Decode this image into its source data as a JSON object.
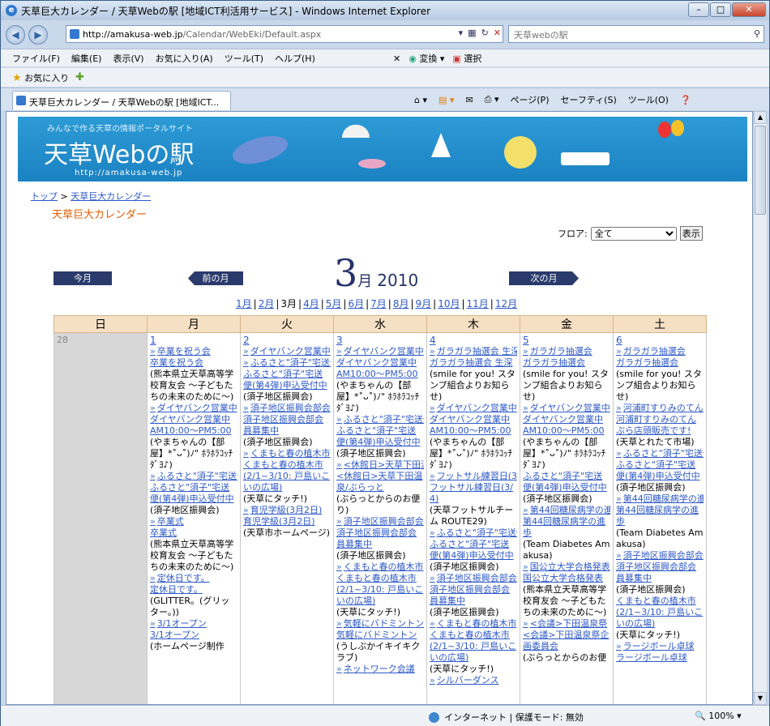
{
  "window": {
    "title": "天草巨大カレンダー / 天草Webの駅 [地域ICT利活用サービス] - Windows Internet Explorer",
    "address_domain": "http://amakusa-web.jp",
    "address_path": "/Calendar/WebEki/Default.aspx",
    "search_placeholder": "天草webの駅"
  },
  "menu": {
    "items": [
      "ファイル(F)",
      "編集(E)",
      "表示(V)",
      "お気に入り(A)",
      "ツール(T)",
      "ヘルプ(H)"
    ],
    "convert": "変換",
    "select": "選択"
  },
  "favorites_label": "お気に入り",
  "tab_label": "天草巨大カレンダー / 天草Webの駅 [地域ICT...",
  "commands": [
    "ページ(P)",
    "セーフティ(S)",
    "ツール(O)"
  ],
  "status": {
    "zone": "インターネット | 保護モード: 無効",
    "zoom": "100%"
  },
  "site": {
    "tagline": "みんなで作る天草の情報ポータルサイト",
    "logo": "天草Webの駅",
    "url": "http://amakusa-web.jp"
  },
  "breadcrumb": {
    "top": "トップ",
    "sep": ">",
    "current": "天草巨大カレンダー"
  },
  "page_title": "天草巨大カレンダー",
  "floor": {
    "label": "フロア:",
    "value": "全て",
    "button": "表示"
  },
  "nav": {
    "this_month": "今月",
    "prev": "前の月",
    "next": "次の月"
  },
  "month": {
    "number": "3",
    "suffix": "月",
    "year": "2010"
  },
  "month_links": [
    "1月",
    "2月",
    "3月",
    "4月",
    "5月",
    "6月",
    "7月",
    "8月",
    "9月",
    "10月",
    "11月",
    "12月"
  ],
  "weekdays": [
    "日",
    "月",
    "火",
    "水",
    "木",
    "金",
    "土"
  ],
  "days": [
    {
      "num": "28",
      "entries": []
    },
    {
      "num": "1",
      "entries": [
        {
          "k": "ev",
          "t": "卒業を祝う会"
        },
        {
          "k": "lk",
          "t": "卒業を祝う会"
        },
        {
          "k": "tx",
          "t": "(熊本県立天草高等学校育友会 ～子どもたちの未来のために～)"
        },
        {
          "k": "ev",
          "t": "ダイヤバンク営業中"
        },
        {
          "k": "lk",
          "t": "ダイヤバンク営業中 AM10:00～PM5:00"
        },
        {
          "k": "tx",
          "t": "(やまちゃんの【部屋】*˚ᴗ˚)ﾉ\" ﾎﾗﾎﾗｺｯﾁﾀﾞﾖ♪)"
        },
        {
          "k": "ev",
          "t": "ふるさと\"須子\"宅送便"
        },
        {
          "k": "lk",
          "t": "ふるさと\"須子\"宅送便(第4弾)申込受付中"
        },
        {
          "k": "tx",
          "t": "(須子地区振興会)"
        },
        {
          "k": "ev",
          "t": "卒業式"
        },
        {
          "k": "lk",
          "t": "卒業式"
        },
        {
          "k": "tx",
          "t": "(熊本県立天草高等学校育友会 ～子どもたちの未来のために～)"
        },
        {
          "k": "ev",
          "t": "定休日です。"
        },
        {
          "k": "lk",
          "t": "定休日です。"
        },
        {
          "k": "tx",
          "t": "(GLITTER。(グリッター。))"
        },
        {
          "k": "ev",
          "t": "3/1オープン"
        },
        {
          "k": "lk",
          "t": "3/1オープン"
        },
        {
          "k": "tx",
          "t": "(ホームページ制作"
        }
      ]
    },
    {
      "num": "2",
      "entries": [
        {
          "k": "ev",
          "t": "ダイヤバンク営業中"
        },
        {
          "k": "ev",
          "t": "ふるさと\"須子\"宅送便"
        },
        {
          "k": "lk",
          "t": "ふるさと\"須子\"宅送便(第4弾)申込受付中"
        },
        {
          "k": "tx",
          "t": "(須子地区振興会)"
        },
        {
          "k": "ev",
          "t": "須子地区振興会部会"
        },
        {
          "k": "lk",
          "t": "須子地区振興会部会員募集中"
        },
        {
          "k": "tx",
          "t": "(須子地区振興会)"
        },
        {
          "k": "ev",
          "t": "くまもと春の植木市"
        },
        {
          "k": "lk",
          "t": "くまもと春の植木市(2/1~3/10: 戸島いこいの広場)"
        },
        {
          "k": "tx",
          "t": "(天草にタッチ!)"
        },
        {
          "k": "ev",
          "t": "育児学級(3月2日)"
        },
        {
          "k": "lk",
          "t": "育児学級(3月2日)"
        },
        {
          "k": "tx",
          "t": "(天草市ホームページ)"
        }
      ]
    },
    {
      "num": "3",
      "entries": [
        {
          "k": "ev",
          "t": "ダイヤバンク営業中"
        },
        {
          "k": "lk",
          "t": "ダイヤバンク営業中 AM10:00～PM5:00"
        },
        {
          "k": "tx",
          "t": "(やまちゃんの【部屋】*˚ᴗ˚)ﾉ\" ﾎﾗﾎﾗｺｯﾁﾀﾞﾖ♪)"
        },
        {
          "k": "ev",
          "t": "ふるさと\"須子\"宅送便"
        },
        {
          "k": "lk",
          "t": "ふるさと\"須子\"宅送便(第4弾)申込受付中"
        },
        {
          "k": "tx",
          "t": "(須子地区振興会)"
        },
        {
          "k": "ev",
          "t": "<休館日>天草下田温泉"
        },
        {
          "k": "lk",
          "t": "<休館日>天草下田温泉/ぶらっと"
        },
        {
          "k": "tx",
          "t": "(ぶらっとからのお便り)"
        },
        {
          "k": "ev",
          "t": "須子地区振興会部会"
        },
        {
          "k": "lk",
          "t": "須子地区振興会部会員募集中"
        },
        {
          "k": "tx",
          "t": "(須子地区振興会)"
        },
        {
          "k": "ev",
          "t": "くまもと春の植木市"
        },
        {
          "k": "lk",
          "t": "くまもと春の植木市(2/1~3/10: 戸島いこいの広場)"
        },
        {
          "k": "tx",
          "t": "(天草にタッチ!)"
        },
        {
          "k": "ev",
          "t": "気軽にバドミントン"
        },
        {
          "k": "lk",
          "t": "気軽にバドミントン"
        },
        {
          "k": "tx",
          "t": "(うしぶかイキイキクラブ)"
        },
        {
          "k": "ev",
          "t": "ネットワーク会議"
        }
      ]
    },
    {
      "num": "4",
      "entries": [
        {
          "k": "ev",
          "t": "ガラガラ抽選会 生深"
        },
        {
          "k": "lk",
          "t": "ガラガラ抽選会 生深"
        },
        {
          "k": "tx",
          "t": "(smile for you! スタンプ組合よりお知らせ)"
        },
        {
          "k": "ev",
          "t": "ダイヤバンク営業中"
        },
        {
          "k": "lk",
          "t": "ダイヤバンク営業中 AM10:00～PM5:00"
        },
        {
          "k": "tx",
          "t": "(やまちゃんの【部屋】*˚ᴗ˚)ﾉ\" ﾎﾗﾎﾗｺｯﾁﾀﾞﾖ♪)"
        },
        {
          "k": "ev",
          "t": "フットサル練習日(3/4)"
        },
        {
          "k": "lk",
          "t": "フットサル練習日(3/4)"
        },
        {
          "k": "tx",
          "t": "(天草フットサルチーム ROUTE29)"
        },
        {
          "k": "ev",
          "t": "ふるさと\"須子\"宅送便"
        },
        {
          "k": "lk",
          "t": "ふるさと\"須子\"宅送便(第4弾)申込受付中"
        },
        {
          "k": "tx",
          "t": "(須子地区振興会)"
        },
        {
          "k": "ev",
          "t": "須子地区振興会部会"
        },
        {
          "k": "lk",
          "t": "須子地区振興会部会員募集中"
        },
        {
          "k": "tx",
          "t": "(須子地区振興会)"
        },
        {
          "k": "ev",
          "t": "くまもと春の植木市"
        },
        {
          "k": "lk",
          "t": "くまもと春の植木市(2/1~3/10: 戸島いこいの広場)"
        },
        {
          "k": "tx",
          "t": "(天草にタッチ!)"
        },
        {
          "k": "ev",
          "t": "シルバーダンス"
        }
      ]
    },
    {
      "num": "5",
      "entries": [
        {
          "k": "ev",
          "t": "ガラガラ抽選会"
        },
        {
          "k": "lk",
          "t": "ガラガラ抽選会"
        },
        {
          "k": "tx",
          "t": "(smile for you! スタンプ組合よりお知らせ)"
        },
        {
          "k": "ev",
          "t": "ダイヤバンク営業中"
        },
        {
          "k": "lk",
          "t": "ダイヤバンク営業中 AM10:00～PM5:00"
        },
        {
          "k": "tx",
          "t": "(やまちゃんの【部屋】*˚ᴗ˚)ﾉ\" ﾎﾗﾎﾗｺｯﾁﾀﾞﾖ♪)"
        },
        {
          "k": "lk",
          "t": "ふるさと\"須子\"宅送便(第4弾)申込受付中"
        },
        {
          "k": "tx",
          "t": "(須子地区振興会)"
        },
        {
          "k": "ev",
          "t": "第44回糖尿病学の進歩"
        },
        {
          "k": "lk",
          "t": "第44回糖尿病学の進歩"
        },
        {
          "k": "tx",
          "t": "(Team Diabetes Amakusa)"
        },
        {
          "k": "ev",
          "t": "国公立大学合格発表"
        },
        {
          "k": "lk",
          "t": "国公立大学合格発表"
        },
        {
          "k": "tx",
          "t": "(熊本県立天草高等学校育友会 ～子どもたちの未来のために～)"
        },
        {
          "k": "ev",
          "t": "<会議>下田温泉祭"
        },
        {
          "k": "lk",
          "t": "<会議>下田温泉祭企画委員会"
        },
        {
          "k": "tx",
          "t": "(ぶらっとからのお便"
        }
      ]
    },
    {
      "num": "6",
      "entries": [
        {
          "k": "ev",
          "t": "ガラガラ抽選会"
        },
        {
          "k": "lk",
          "t": "ガラガラ抽選会"
        },
        {
          "k": "tx",
          "t": "(smile for you! スタンプ組合よりお知らせ)"
        },
        {
          "k": "ev",
          "t": "河浦町すりみのてんぷら"
        },
        {
          "k": "lk",
          "t": "河浦町すりみのてんぷら店頭販売です!"
        },
        {
          "k": "tx",
          "t": "(天草とれたて市場)"
        },
        {
          "k": "ev",
          "t": "ふるさと\"須子\"宅送便"
        },
        {
          "k": "lk",
          "t": "ふるさと\"須子\"宅送便(第4弾)申込受付中"
        },
        {
          "k": "tx",
          "t": "(須子地区振興会)"
        },
        {
          "k": "ev",
          "t": "第44回糖尿病学の進歩"
        },
        {
          "k": "lk",
          "t": "第44回糖尿病学の進歩"
        },
        {
          "k": "tx",
          "t": "(Team Diabetes Amakusa)"
        },
        {
          "k": "ev",
          "t": "須子地区振興会部会"
        },
        {
          "k": "lk",
          "t": "須子地区振興会部会員募集中"
        },
        {
          "k": "tx",
          "t": "(須子地区振興会)"
        },
        {
          "k": "lk",
          "t": "くまもと春の植木市(2/1~3/10: 戸島いこいの広場)"
        },
        {
          "k": "tx",
          "t": "(天草にタッチ!)"
        },
        {
          "k": "ev",
          "t": "ラージボール卓球"
        },
        {
          "k": "lk",
          "t": "ラージボール卓球"
        }
      ]
    }
  ]
}
